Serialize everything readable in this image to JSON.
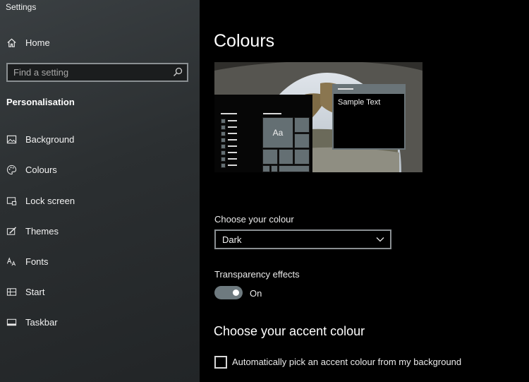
{
  "window": {
    "title": "Settings"
  },
  "sidebar": {
    "home_label": "Home",
    "search_placeholder": "Find a setting",
    "section_title": "Personalisation",
    "items": [
      {
        "label": "Background",
        "icon": "image-icon"
      },
      {
        "label": "Colours",
        "icon": "palette-icon"
      },
      {
        "label": "Lock screen",
        "icon": "lock-screen-icon"
      },
      {
        "label": "Themes",
        "icon": "themes-icon"
      },
      {
        "label": "Fonts",
        "icon": "fonts-icon"
      },
      {
        "label": "Start",
        "icon": "start-icon"
      },
      {
        "label": "Taskbar",
        "icon": "taskbar-icon"
      }
    ]
  },
  "main": {
    "title": "Colours",
    "preview": {
      "tile_text": "Aa",
      "sample_text": "Sample Text"
    },
    "choose_colour": {
      "label": "Choose your colour",
      "value": "Dark"
    },
    "transparency": {
      "label": "Transparency effects",
      "state": "On",
      "enabled": true
    },
    "accent": {
      "title": "Choose your accent colour",
      "auto_pick_label": "Automatically pick an accent colour from my background",
      "auto_pick_checked": false
    }
  },
  "colors": {
    "accent": "#6e7a7f",
    "sidebar_bg": "#2f3335",
    "main_bg": "#000000",
    "text": "#ffffff"
  }
}
